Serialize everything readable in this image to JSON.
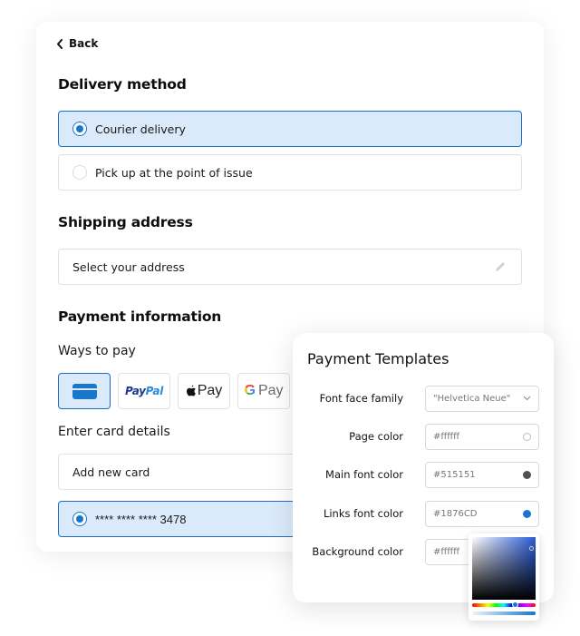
{
  "back_label": "Back",
  "delivery": {
    "title": "Delivery method",
    "options": [
      {
        "label": "Courier delivery",
        "selected": true
      },
      {
        "label": "Pick up at the point of issue",
        "selected": false
      }
    ]
  },
  "shipping": {
    "title": "Shipping address",
    "placeholder": "Select your address",
    "edit_icon": "pencil-icon"
  },
  "payment": {
    "title": "Payment information",
    "ways_label": "Ways to pay",
    "methods": [
      {
        "name": "card",
        "icon": "credit-card-icon",
        "selected": true
      },
      {
        "name": "PayPal",
        "parts": [
          "Pay",
          "Pal"
        ],
        "selected": false
      },
      {
        "name": "Apple Pay",
        "logo": "",
        "text": "Pay",
        "selected": false
      },
      {
        "name": "Google Pay",
        "logo": "G",
        "text": "Pay",
        "selected": false
      }
    ],
    "card_details_label": "Enter card details",
    "add_card_label": "Add new card",
    "saved_card": "**** **** **** 3478"
  },
  "templates": {
    "title": "Payment Templates",
    "rows": [
      {
        "label": "Font face family",
        "value": "\"Helvetica Neue\"",
        "type": "select"
      },
      {
        "label": "Page color",
        "value": "#ffffff",
        "swatch": "#ffffff"
      },
      {
        "label": "Main font color",
        "value": "#515151",
        "swatch": "#515151"
      },
      {
        "label": "Links font color",
        "value": "#1876CD",
        "swatch": "#1876CD"
      },
      {
        "label": "Background color",
        "value": "#ffffff",
        "swatch": "#ffffff"
      }
    ]
  },
  "colors": {
    "accent": "#1876CD",
    "selected_bg": "#DBEAFB"
  }
}
